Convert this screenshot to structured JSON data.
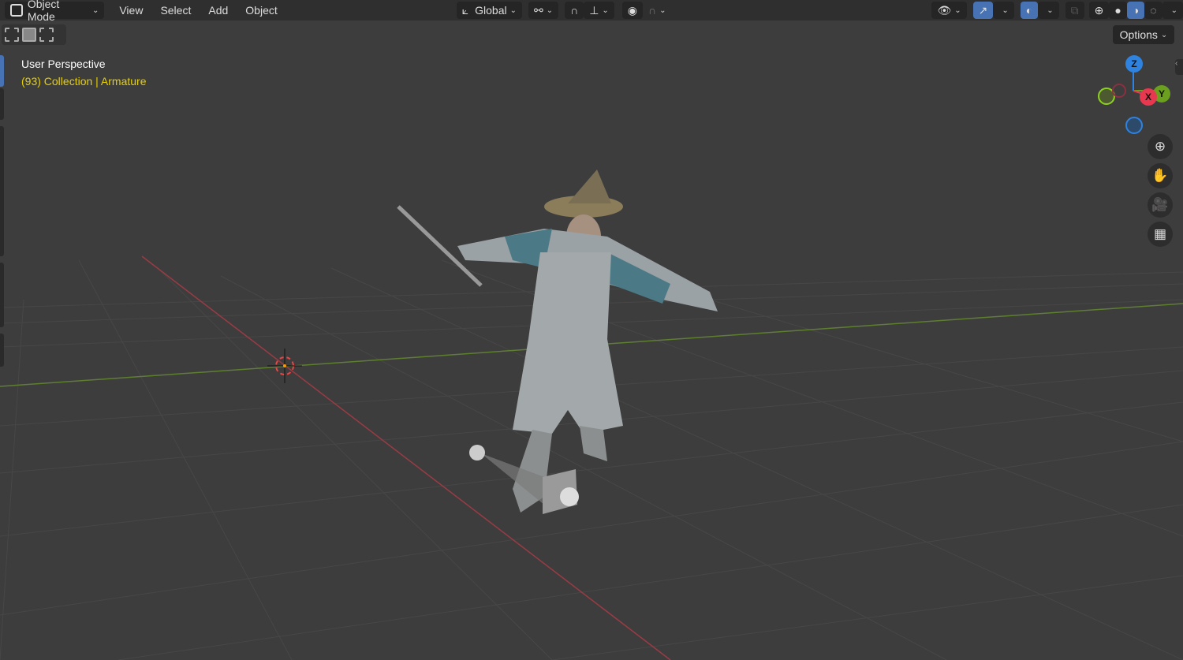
{
  "header": {
    "mode": "Object Mode",
    "menus": [
      "View",
      "Select",
      "Add",
      "Object"
    ],
    "transform_orientation": "Global"
  },
  "viewport": {
    "view_name": "User Perspective",
    "collection_info": "(93) Collection | Armature",
    "options_label": "Options"
  },
  "gizmo": {
    "z": "Z",
    "x": "X",
    "y": "Y"
  },
  "colors": {
    "accent": "#4772b3",
    "x_axis": "#e8384f",
    "y_axis": "#6ba01e",
    "z_axis": "#2f83e0",
    "info_text": "#e8d000"
  }
}
